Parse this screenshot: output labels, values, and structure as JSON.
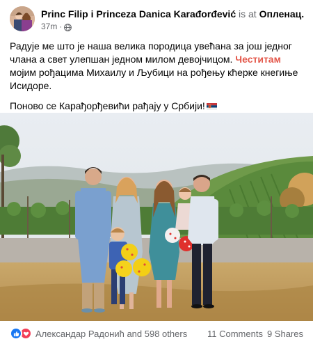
{
  "post": {
    "author": "Princ Filip i Princeza Danica Karađorđević",
    "is_at": "is at",
    "place": "Опленац.",
    "time": "37m",
    "time_sep": "·",
    "privacy_icon": "globe-icon",
    "paragraph1_a": "Радује ме што је наша велика породица увећана за још једног члана а свет улепшан једном милом девојчицом. ",
    "hashtag": "Честитам",
    "paragraph1_b": " мојим рођацима Михаилу и Љубици на рођењу кћерке кнегиње Исидоре.",
    "paragraph2": "Поново се Карађорђевићи рађају у Србији!",
    "flag_icon": "serbian-flag-icon"
  },
  "footer": {
    "reaction_icons": [
      "like-icon",
      "love-icon"
    ],
    "reactions_text": "Александар Радонић and 598 others",
    "comments": "11 Comments",
    "shares": "9 Shares"
  },
  "colors": {
    "like": "#1877f2",
    "love": "#f33e58",
    "hashtag": "#e4584b",
    "secondary_text": "#65676b"
  }
}
